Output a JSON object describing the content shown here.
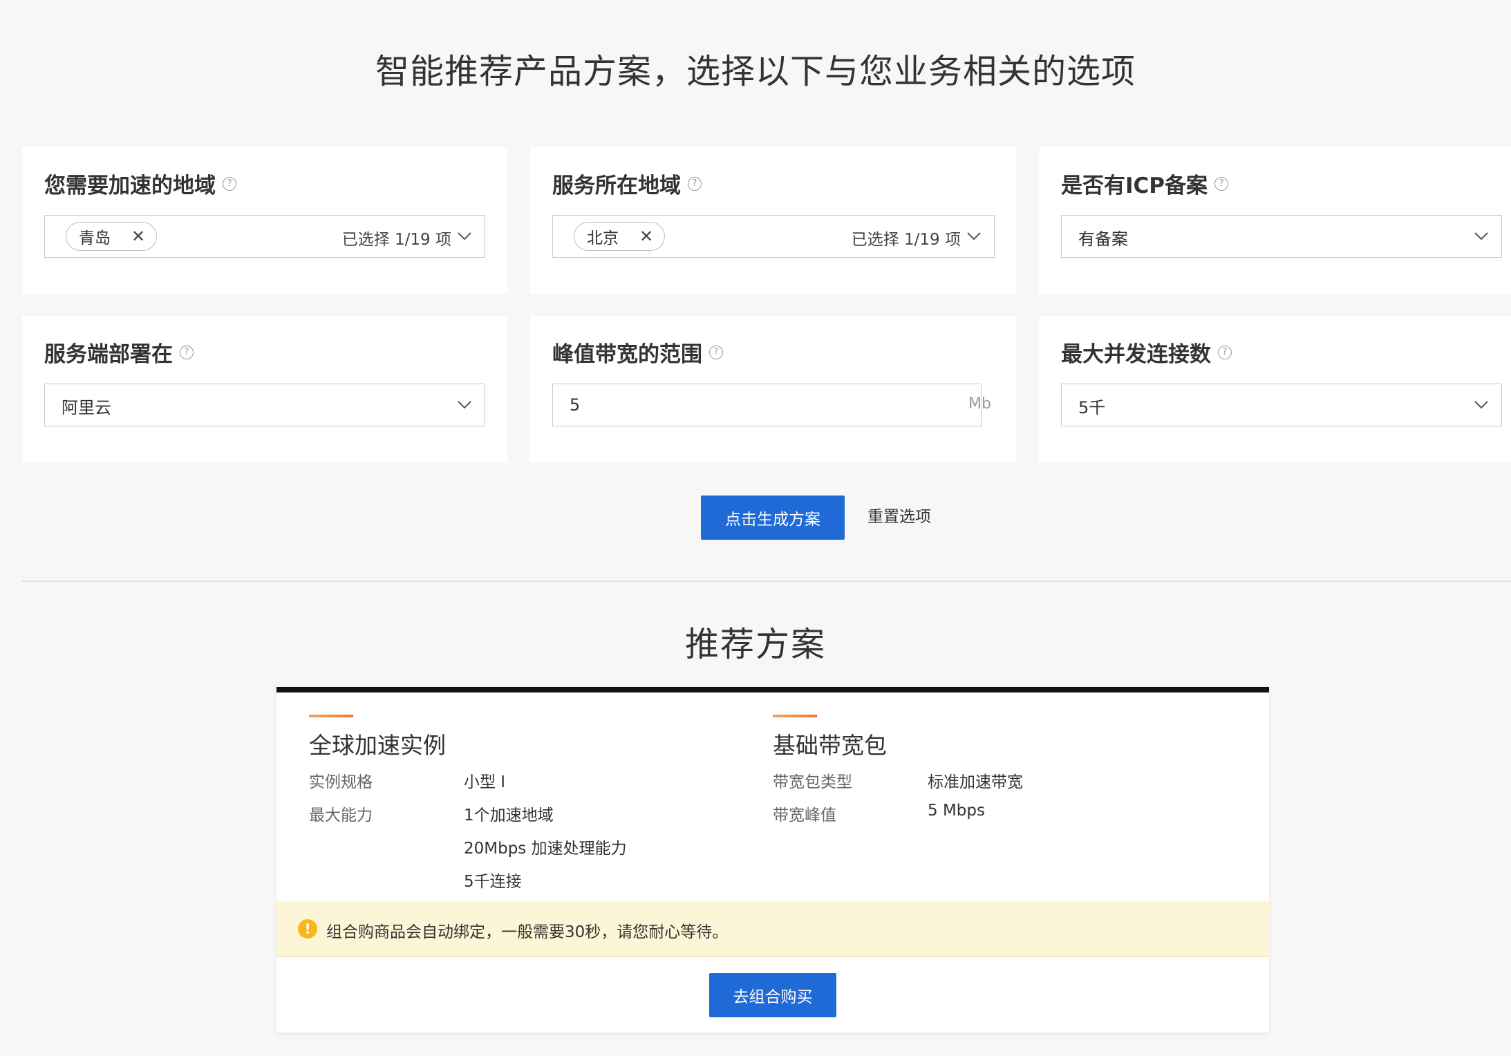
{
  "page": {
    "title": "智能推荐产品方案，选择以下与您业务相关的选项"
  },
  "form": {
    "accel_region": {
      "label": "您需要加速的地域",
      "tag": "青岛",
      "count_text": "已选择 1/19 项"
    },
    "service_region": {
      "label": "服务所在地域",
      "tag": "北京",
      "count_text": "已选择 1/19 项"
    },
    "icp": {
      "label": "是否有ICP备案",
      "value": "有备案"
    },
    "deployment": {
      "label": "服务端部署在",
      "value": "阿里云"
    },
    "peak_bandwidth": {
      "label": "峰值带宽的范围",
      "value": "5",
      "unit": "Mb"
    },
    "max_connections": {
      "label": "最大并发连接数",
      "value": "5千"
    },
    "help_symbol": "?",
    "close_symbol": "✕",
    "generate_label": "点击生成方案",
    "reset_label": "重置选项"
  },
  "recommendation": {
    "title": "推荐方案",
    "instance": {
      "title": "全球加速实例",
      "rows": [
        {
          "label": "实例规格",
          "value": "小型 I"
        },
        {
          "label": "最大能力",
          "value": "1个加速地域"
        },
        {
          "label": "",
          "value": "20Mbps 加速处理能力"
        },
        {
          "label": "",
          "value": "5千连接"
        }
      ]
    },
    "bandwidth": {
      "title": "基础带宽包",
      "rows": [
        {
          "label": "带宽包类型",
          "value": "标准加速带宽"
        },
        {
          "label": "带宽峰值",
          "value": "5 Mbps"
        }
      ]
    },
    "notice_symbol": "!",
    "notice": "组合购商品会自动绑定，一般需要30秒，请您耐心等待。",
    "buy_label": "去组合购买"
  },
  "colors": {
    "primary": "#1f6ad6",
    "notice_bg": "#fdf6d6",
    "warning": "#f5b91d",
    "accent": "#e8763a"
  }
}
